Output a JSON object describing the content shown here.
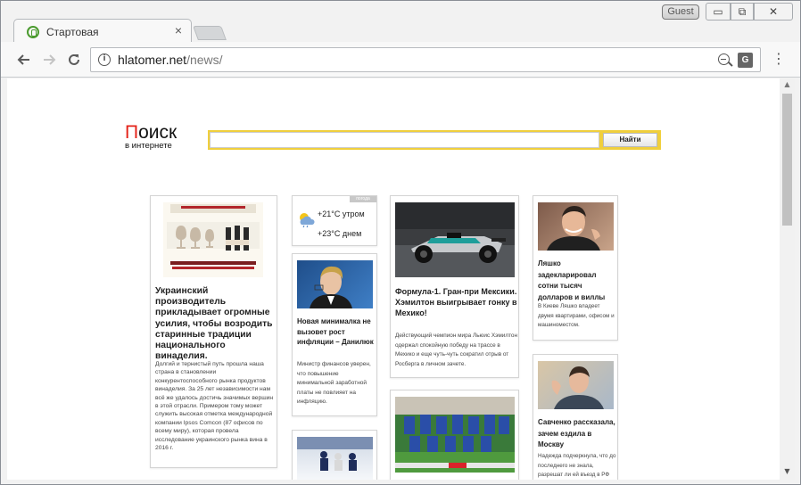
{
  "browser": {
    "tab_title": "Стартовая",
    "tab_close": "×",
    "guest_label": "Guest",
    "win_min": "▭",
    "win_max": "⧉",
    "win_close": "✕",
    "url_host": "hlatomer.net",
    "url_path": "/news/",
    "icons": [
      "back-arrow-icon",
      "forward-arrow-icon",
      "reload-icon",
      "info-icon",
      "zoom-icon",
      "translate-icon",
      "menu-icon"
    ]
  },
  "search": {
    "logo_first": "П",
    "logo_rest": "оиск",
    "logo_sub": "в интернете",
    "button": "Найти"
  },
  "weather": {
    "badge": "погода",
    "morning": "+21°C утром",
    "day": "+23°C днем"
  },
  "cards": {
    "winery": {
      "title": "Украинский производитель прикладывает огромные усилия, чтобы возродить старинные традиции национального винаделия.",
      "text": "Долгий и тернистый путь прошла наша страна в становлении конкурентоспособного рынка продуктов винаделия. За 25 лет независимости нам всё же удалось достичь значимых вершин в этой отрасли. Примером тому может служить высокая отметка международной компании Ipsos Comcon (87 офисов по всему миру), которая провела исследование украинского рынка вина в 2016 г."
    },
    "danilyuk": {
      "title": "Новая минималка не вызовет рост инфляции – Данилюк",
      "text": "Министр финансов уверен, что повышение минимальной заработной платы не повлияет на инфляцию."
    },
    "formula": {
      "title": "Формула-1. Гран-при Мексики. Хэмилтон выигрывает гонку в Мехико!",
      "text": "Действующий чемпион мира Льюис Хэмилтон одержал спокойную победу на трассе в Мехико и еще чуть-чуть сократил отрыв от Росберга в личном зачете."
    },
    "lyashko": {
      "title": "Ляшко задекларировал сотни тысяч долларов и виллы",
      "text": "В Киеве Ляшко владеет двумя квартирами, офисом и машиноместом."
    },
    "savchenko": {
      "title": "Савченко рассказала, зачем ездила в Москву",
      "text": "Надеждa подчеркнула, что до последнего не знала, разрешат ли ей въезд в РФ"
    }
  },
  "colors": {
    "logo_red": "#e4231a",
    "search_border": "#f0cf3c"
  }
}
